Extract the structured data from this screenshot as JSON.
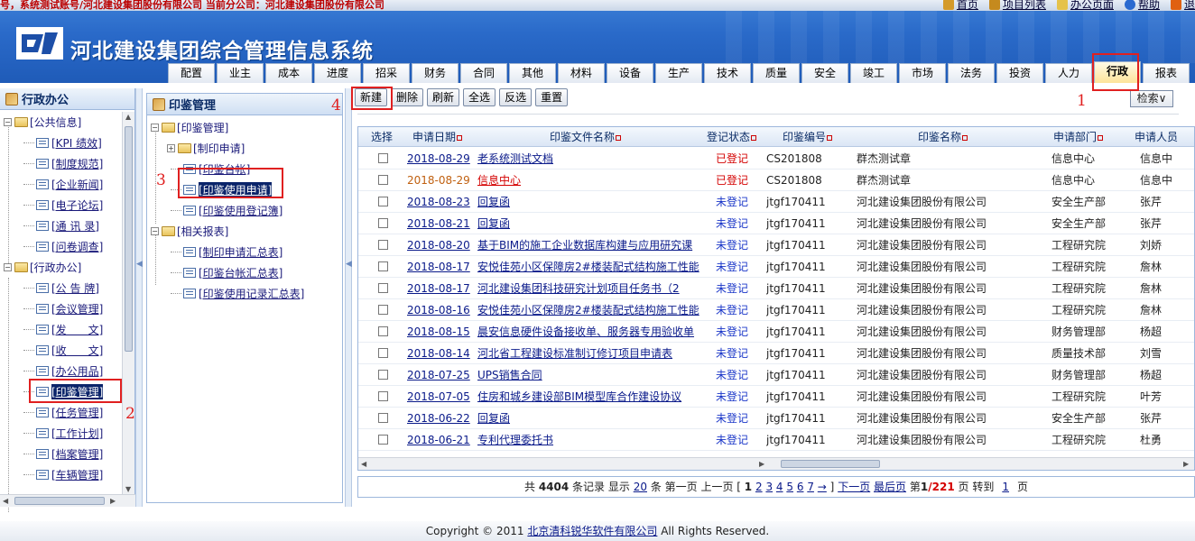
{
  "header": {
    "account_text": "号，系统测试账号/河北建设集团股份有限公司    当前分公司：河北建设集团股份有限公司",
    "system_title": "河北建设集团综合管理信息系统",
    "top_links": [
      "首页",
      "项目列表",
      "办公页面",
      "帮助",
      "退"
    ],
    "nav_tabs": [
      "配置",
      "业主",
      "成本",
      "进度",
      "招采",
      "财务",
      "合同",
      "其他",
      "材料",
      "设备",
      "生产",
      "技术",
      "质量",
      "安全",
      "竣工",
      "市场",
      "法务",
      "投资",
      "人力",
      "行政",
      "报表"
    ],
    "active_tab": "行政"
  },
  "left_pane": {
    "title": "行政办公",
    "groups": [
      {
        "label": "[公共信息]",
        "items": [
          "[KPI 绩效]",
          "[制度规范]",
          "[企业新闻]",
          "[电子论坛]",
          "[通 讯 录]",
          "[问卷调查]"
        ]
      },
      {
        "label": "[行政办公]",
        "items": [
          "[公 告 牌]",
          "[会议管理]",
          "[发　　文]",
          "[收　　文]",
          "[办公用品]",
          "[印鉴管理]",
          "[任务管理]",
          "[工作计划]",
          "[档案管理]",
          "[车辆管理]"
        ]
      }
    ],
    "selected": "[印鉴管理]"
  },
  "middle_pane": {
    "title": "印鉴管理",
    "root": "[印鉴管理]",
    "sub": [
      "[制印申请]",
      "[印鉴台帐]",
      "[印鉴使用申请]",
      "[印鉴使用登记簿]"
    ],
    "reports_root": "[相关报表]",
    "reports": [
      "[制印申请汇总表]",
      "[印鉴台帐汇总表]",
      "[印鉴使用记录汇总表]"
    ],
    "selected": "[印鉴使用申请]"
  },
  "toolbar": {
    "buttons": [
      "新建",
      "删除",
      "刷新",
      "全选",
      "反选",
      "重置"
    ],
    "search": "检索∨"
  },
  "grid": {
    "headers": [
      "选择",
      "申请日期",
      "印鉴文件名称",
      "登记状态",
      "印鉴编号",
      "印鉴名称",
      "申请部门",
      "申请人员"
    ],
    "rows": [
      {
        "date": "2018-08-29",
        "name": "老系统测试文档",
        "status": "已登记",
        "code": "CS201808",
        "seal": "群杰测试章",
        "dept": "信息中心",
        "person": "信息中"
      },
      {
        "date": "2018-08-29",
        "name": "信息中心",
        "status": "已登记",
        "code": "CS201808",
        "seal": "群杰测试章",
        "dept": "信息中心",
        "person": "信息中"
      },
      {
        "date": "2018-08-23",
        "name": "回复函",
        "status": "未登记",
        "code": "jtgf170411",
        "seal": "河北建设集团股份有限公司",
        "dept": "安全生产部",
        "person": "张芹"
      },
      {
        "date": "2018-08-21",
        "name": "回复函",
        "status": "未登记",
        "code": "jtgf170411",
        "seal": "河北建设集团股份有限公司",
        "dept": "安全生产部",
        "person": "张芹"
      },
      {
        "date": "2018-08-20",
        "name": "基于BIM的施工企业数据库构建与应用研究课",
        "status": "未登记",
        "code": "jtgf170411",
        "seal": "河北建设集团股份有限公司",
        "dept": "工程研究院",
        "person": "刘娇"
      },
      {
        "date": "2018-08-17",
        "name": "安悦佳苑小区保障房2#楼装配式结构施工性能",
        "status": "未登记",
        "code": "jtgf170411",
        "seal": "河北建设集团股份有限公司",
        "dept": "工程研究院",
        "person": "詹林"
      },
      {
        "date": "2018-08-17",
        "name": "河北建设集团科技研究计划项目任务书（2",
        "status": "未登记",
        "code": "jtgf170411",
        "seal": "河北建设集团股份有限公司",
        "dept": "工程研究院",
        "person": "詹林"
      },
      {
        "date": "2018-08-16",
        "name": "安悦佳苑小区保障房2#楼装配式结构施工性能",
        "status": "未登记",
        "code": "jtgf170411",
        "seal": "河北建设集团股份有限公司",
        "dept": "工程研究院",
        "person": "詹林"
      },
      {
        "date": "2018-08-15",
        "name": "晨安信息硬件设备接收单、服务器专用验收单",
        "status": "未登记",
        "code": "jtgf170411",
        "seal": "河北建设集团股份有限公司",
        "dept": "财务管理部",
        "person": "杨超"
      },
      {
        "date": "2018-08-14",
        "name": "河北省工程建设标准制订修订项目申请表",
        "status": "未登记",
        "code": "jtgf170411",
        "seal": "河北建设集团股份有限公司",
        "dept": "质量技术部",
        "person": "刘雪"
      },
      {
        "date": "2018-07-25",
        "name": "UPS销售合同",
        "status": "未登记",
        "code": "jtgf170411",
        "seal": "河北建设集团股份有限公司",
        "dept": "财务管理部",
        "person": "杨超"
      },
      {
        "date": "2018-07-05",
        "name": "住房和城乡建设部BIM模型库合作建设协议",
        "status": "未登记",
        "code": "jtgf170411",
        "seal": "河北建设集团股份有限公司",
        "dept": "工程研究院",
        "person": "叶芳"
      },
      {
        "date": "2018-06-22",
        "name": "回复函",
        "status": "未登记",
        "code": "jtgf170411",
        "seal": "河北建设集团股份有限公司",
        "dept": "安全生产部",
        "person": "张芹"
      },
      {
        "date": "2018-06-21",
        "name": "专利代理委托书",
        "status": "未登记",
        "code": "jtgf170411",
        "seal": "河北建设集团股份有限公司",
        "dept": "工程研究院",
        "person": "杜勇"
      }
    ]
  },
  "pager": {
    "total_prefix": "共",
    "total": "4404",
    "total_suffix": "条记录 显示",
    "page_size": "20",
    "page_size_suffix": "条 第一页 上一页 [",
    "current": "1",
    "pages": [
      "2",
      "3",
      "4",
      "5",
      "6",
      "7"
    ],
    "next_arrow": "→",
    "close_bracket": "]",
    "next": "下一页",
    "last": "最后页",
    "page_label": "第",
    "page_current": "1",
    "page_total": "/221",
    "page_suffix": "页 转到",
    "goto": "1",
    "goto_suffix": "页"
  },
  "annotations": [
    "1",
    "2",
    "3",
    "4"
  ],
  "footer": {
    "prefix": "Copyright © 2011",
    "company": "北京清科锐华软件有限公司",
    "suffix": "All Rights Reserved."
  }
}
